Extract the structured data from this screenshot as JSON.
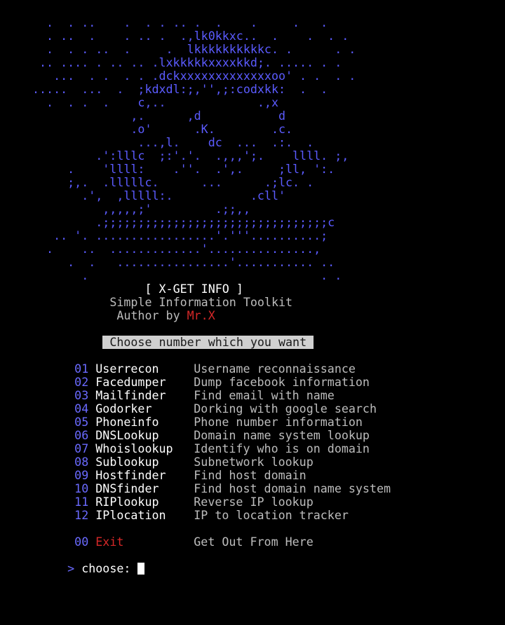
{
  "ascii_art": [
    "  .  . ..    .  . . .. .  .    .     .   .",
    "  . ..  .    . .. .  .,lk0kkxc..  .    .  . .",
    "  .  . . ..  .     .  lkkkkkkkkkkc. .      . .",
    " .. .... . .. .. .lxkkkkkxxxxkkd;. ..... . .",
    "   ...  . .  . . .dckxxxxxxxxxxxxxoo' . .  . .",
    ".....  ...  .  ;kdxdl:;,'',;:codxkk:  .  .",
    "  .  . .  .    c,..             .,x",
    "              ,.      ,d           d",
    "              .o'      .K.        .c.",
    "               ...,l.    dc  ...  .:.  .",
    "         .':lllc  ;:'.'.  .,,,';.    llll. ;,",
    "     .    'llll:    .''.  .',.     ;ll, ':.",
    "     ;,.  .lllllc.      ...      .;lc. .",
    "       .',  ,lllll:.           .cll'",
    "          ,,,,,;'         .;;,,",
    "         .;;;;;;;;;;;;;;;;;;;;;;;;;;;;;;;;c",
    "   .. '. .................'.'''..........;",
    "  .    ..  .............'...............,",
    "     .  .   ................'........... ..",
    "       .                                 . ."
  ],
  "title": "[ X-GET INFO ]",
  "subtitle": "Simple Information Toolkit",
  "author_label": "Author by ",
  "author_name": "Mr.X",
  "prompt_banner": "Choose number which you want",
  "menu": [
    {
      "num": "01",
      "name": "Userrecon",
      "desc": "Username reconnaissance"
    },
    {
      "num": "02",
      "name": "Facedumper",
      "desc": "Dump facebook information"
    },
    {
      "num": "03",
      "name": "Mailfinder",
      "desc": "Find email with name"
    },
    {
      "num": "04",
      "name": "Godorker",
      "desc": "Dorking with google search"
    },
    {
      "num": "05",
      "name": "Phoneinfo",
      "desc": "Phone number information"
    },
    {
      "num": "06",
      "name": "DNSLookup",
      "desc": "Domain name system lookup"
    },
    {
      "num": "07",
      "name": "Whoislookup",
      "desc": "Identify who is on domain"
    },
    {
      "num": "08",
      "name": "Sublookup",
      "desc": "Subnetwork lookup"
    },
    {
      "num": "09",
      "name": "Hostfinder",
      "desc": "Find host domain"
    },
    {
      "num": "10",
      "name": "DNSfinder",
      "desc": "Find host domain name system"
    },
    {
      "num": "11",
      "name": "RIPlookup",
      "desc": "Reverse IP lookup"
    },
    {
      "num": "12",
      "name": "IPlocation",
      "desc": "IP to location tracker"
    }
  ],
  "exit": {
    "num": "00",
    "name": "Exit",
    "desc": "Get Out From Here"
  },
  "prompt": {
    "marker": ">",
    "label": "choose:"
  },
  "colors": {
    "background": "#000000",
    "ascii_art": "#5b5bff",
    "number": "#6a6aff",
    "tool_name": "#ffffff",
    "description": "#bdbdbd",
    "exit": "#d62828",
    "author": "#d62828",
    "banner_bg": "#d0d0d0"
  }
}
